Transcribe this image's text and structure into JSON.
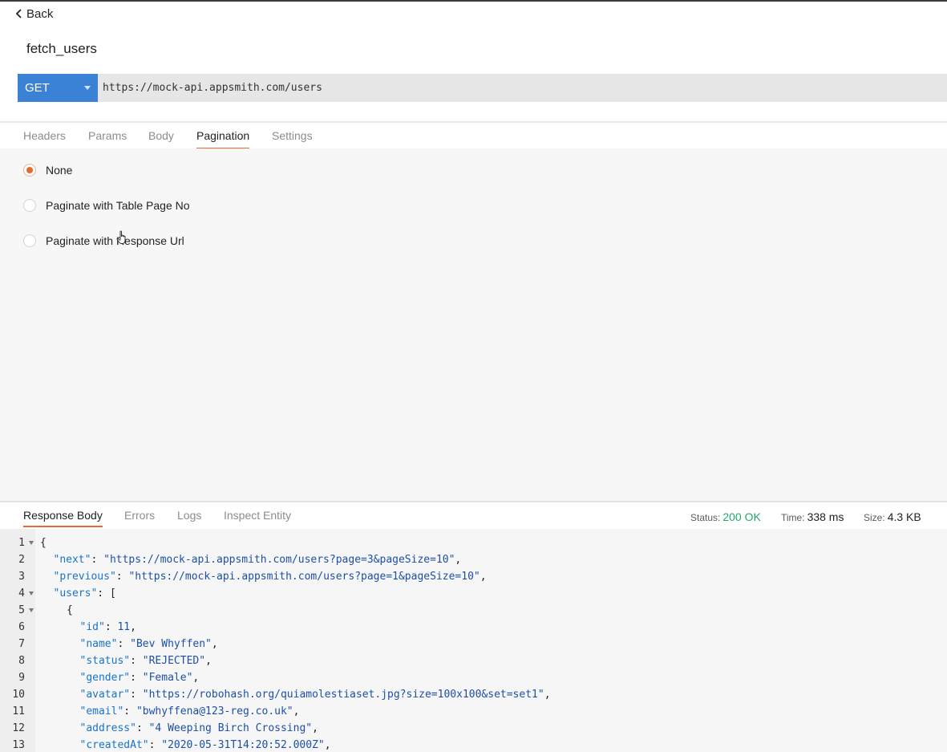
{
  "header": {
    "back_label": "Back",
    "title": "fetch_users"
  },
  "request": {
    "method": "GET",
    "url": "https://mock-api.appsmith.com/users"
  },
  "tabs": [
    "Headers",
    "Params",
    "Body",
    "Pagination",
    "Settings"
  ],
  "active_tab": "Pagination",
  "pagination": {
    "options": [
      "None",
      "Paginate with Table Page No",
      "Paginate with Response Url"
    ],
    "selected": "None"
  },
  "response": {
    "tabs": [
      "Response Body",
      "Errors",
      "Logs",
      "Inspect Entity"
    ],
    "active_tab": "Response Body",
    "status_label": "Status:",
    "status_value": "200 OK",
    "time_label": "Time:",
    "time_value": "338 ms",
    "size_label": "Size:",
    "size_value": "4.3 KB",
    "lines": [
      {
        "n": "1",
        "fold": true,
        "indent": 0,
        "key": "",
        "value": "",
        "text": "{"
      },
      {
        "n": "2",
        "fold": false,
        "indent": 1,
        "key": "\"next\"",
        "value": "\"https://mock-api.appsmith.com/users?page=3&pageSize=10\"",
        "text": ","
      },
      {
        "n": "3",
        "fold": false,
        "indent": 1,
        "key": "\"previous\"",
        "value": "\"https://mock-api.appsmith.com/users?page=1&pageSize=10\"",
        "text": ","
      },
      {
        "n": "4",
        "fold": true,
        "indent": 1,
        "key": "\"users\"",
        "value": "",
        "text": "["
      },
      {
        "n": "5",
        "fold": true,
        "indent": 2,
        "key": "",
        "value": "",
        "text": "{"
      },
      {
        "n": "6",
        "fold": false,
        "indent": 3,
        "key": "\"id\"",
        "value": "11",
        "text": ","
      },
      {
        "n": "7",
        "fold": false,
        "indent": 3,
        "key": "\"name\"",
        "value": "\"Bev Whyffen\"",
        "text": ","
      },
      {
        "n": "8",
        "fold": false,
        "indent": 3,
        "key": "\"status\"",
        "value": "\"REJECTED\"",
        "text": ","
      },
      {
        "n": "9",
        "fold": false,
        "indent": 3,
        "key": "\"gender\"",
        "value": "\"Female\"",
        "text": ","
      },
      {
        "n": "10",
        "fold": false,
        "indent": 3,
        "key": "\"avatar\"",
        "value": "\"https://robohash.org/quiamolestiaset.jpg?size=100x100&set=set1\"",
        "text": ","
      },
      {
        "n": "11",
        "fold": false,
        "indent": 3,
        "key": "\"email\"",
        "value": "\"bwhyffena@123-reg.co.uk\"",
        "text": ","
      },
      {
        "n": "12",
        "fold": false,
        "indent": 3,
        "key": "\"address\"",
        "value": "\"4 Weeping Birch Crossing\"",
        "text": ","
      },
      {
        "n": "13",
        "fold": false,
        "indent": 3,
        "key": "\"createdAt\"",
        "value": "\"2020-05-31T14:20:52.000Z\"",
        "text": ","
      }
    ]
  },
  "colors": {
    "accent": "#e56d2b",
    "method_bg": "#3b82d6",
    "status_ok": "#25a66a",
    "json_key": "#1a73c9",
    "json_value": "#1d4fa6"
  }
}
